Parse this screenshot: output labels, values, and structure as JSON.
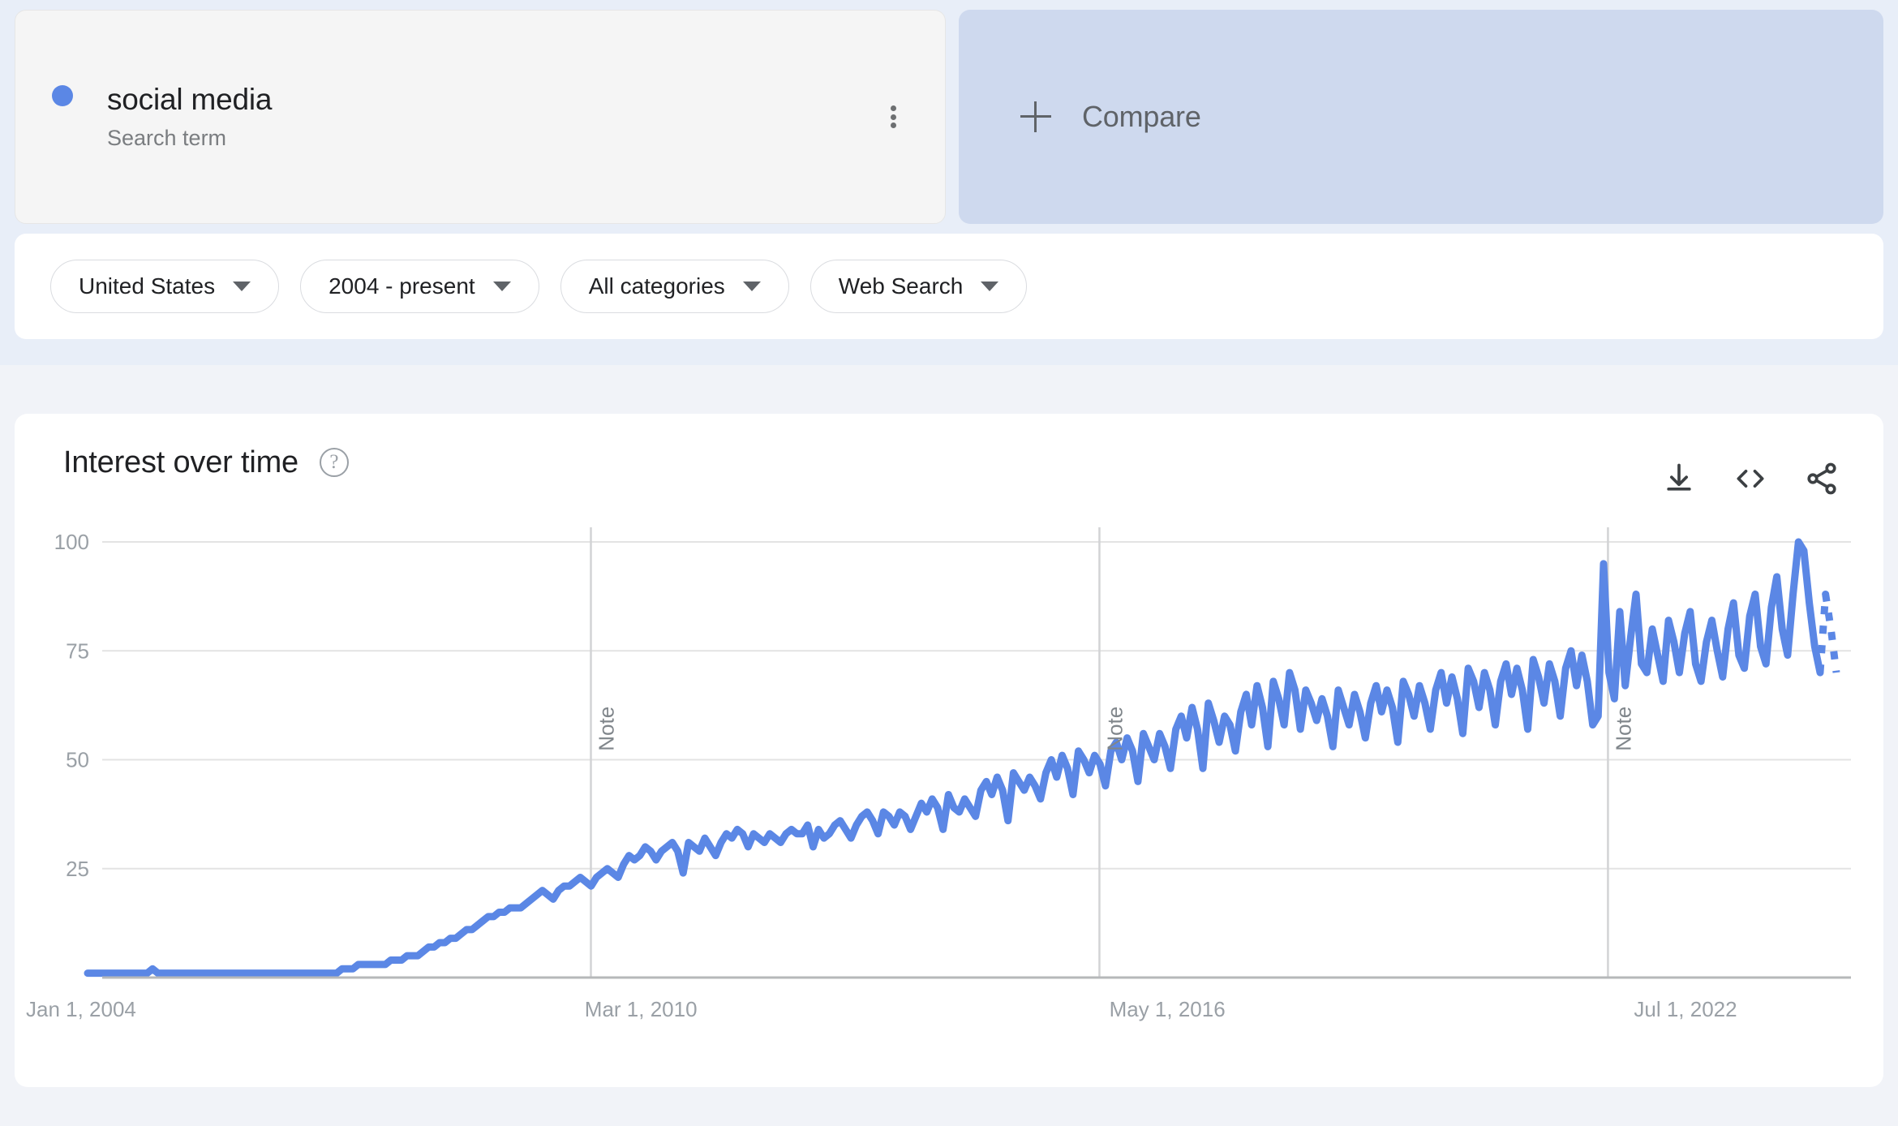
{
  "query": {
    "term": "social media",
    "type_label": "Search term",
    "dot_color": "#5b87e5",
    "menu_icon": "kebab-menu-icon"
  },
  "compare": {
    "label": "Compare",
    "icon": "plus-icon",
    "background": "#ced9ee"
  },
  "filters": [
    {
      "label": "United States",
      "name": "location"
    },
    {
      "label": "2004 - present",
      "name": "time-range"
    },
    {
      "label": "All categories",
      "name": "category"
    },
    {
      "label": "Web Search",
      "name": "search-type"
    }
  ],
  "chart_card": {
    "title": "Interest over time",
    "help_icon": "help-circle-icon",
    "actions": [
      {
        "name": "download-icon",
        "label": "Download"
      },
      {
        "name": "embed-code-icon",
        "label": "Embed"
      },
      {
        "name": "share-icon",
        "label": "Share"
      }
    ]
  },
  "chart_data": {
    "type": "line",
    "title": "Interest over time",
    "xlabel": "",
    "ylabel": "",
    "ylim": [
      0,
      100
    ],
    "xlim": [
      "Jan 1, 2004",
      "2024"
    ],
    "grid": true,
    "legend": false,
    "line_color": "#5b87e5",
    "y_ticks": [
      25,
      50,
      75,
      100
    ],
    "y_tick_labels": [
      "25",
      "50",
      "75",
      "100"
    ],
    "x_tick_labels": [
      "Jan 1, 2004",
      "Mar 1, 2010",
      "May 1, 2016",
      "Jul 1, 2022"
    ],
    "x_tick_positions": [
      0,
      0.3,
      0.6,
      0.9
    ],
    "annotations": [
      {
        "label": "Note",
        "x_fraction": 0.2878,
        "orientation": "vertical"
      },
      {
        "label": "Note",
        "x_fraction": 0.5786,
        "orientation": "vertical"
      },
      {
        "label": "Note",
        "x_fraction": 0.8694,
        "orientation": "vertical"
      }
    ],
    "series": [
      {
        "name": "social media",
        "dashed_tail_points": 3,
        "values": [
          1,
          1,
          1,
          1,
          1,
          1,
          1,
          1,
          1,
          1,
          1,
          1,
          2,
          1,
          1,
          1,
          1,
          1,
          1,
          1,
          1,
          1,
          1,
          1,
          1,
          1,
          1,
          1,
          1,
          1,
          1,
          1,
          1,
          1,
          1,
          1,
          1,
          1,
          1,
          1,
          1,
          1,
          1,
          1,
          1,
          1,
          1,
          2,
          2,
          2,
          3,
          3,
          3,
          3,
          3,
          3,
          4,
          4,
          4,
          5,
          5,
          5,
          6,
          7,
          7,
          8,
          8,
          9,
          9,
          10,
          11,
          11,
          12,
          13,
          14,
          14,
          15,
          15,
          16,
          16,
          16,
          17,
          18,
          19,
          20,
          19,
          18,
          20,
          21,
          21,
          22,
          23,
          22,
          21,
          23,
          24,
          25,
          24,
          23,
          26,
          28,
          27,
          28,
          30,
          29,
          27,
          29,
          30,
          31,
          29,
          24,
          31,
          30,
          29,
          32,
          30,
          28,
          31,
          33,
          32,
          34,
          33,
          30,
          33,
          32,
          31,
          33,
          32,
          31,
          33,
          34,
          33,
          33,
          35,
          30,
          34,
          32,
          33,
          35,
          36,
          34,
          32,
          35,
          37,
          38,
          36,
          33,
          38,
          37,
          35,
          38,
          37,
          34,
          37,
          40,
          38,
          41,
          39,
          34,
          42,
          39,
          38,
          41,
          39,
          37,
          43,
          45,
          42,
          46,
          43,
          36,
          47,
          45,
          43,
          46,
          44,
          41,
          47,
          50,
          46,
          51,
          48,
          42,
          52,
          50,
          47,
          51,
          49,
          44,
          52,
          54,
          50,
          55,
          52,
          45,
          56,
          53,
          50,
          56,
          53,
          48,
          57,
          60,
          55,
          62,
          57,
          48,
          63,
          59,
          54,
          60,
          58,
          52,
          61,
          65,
          58,
          67,
          62,
          53,
          68,
          64,
          58,
          70,
          66,
          57,
          66,
          63,
          59,
          64,
          60,
          53,
          66,
          62,
          58,
          65,
          61,
          55,
          63,
          67,
          61,
          66,
          62,
          54,
          68,
          65,
          60,
          67,
          63,
          57,
          66,
          70,
          63,
          69,
          64,
          56,
          71,
          68,
          62,
          70,
          66,
          58,
          68,
          72,
          65,
          71,
          66,
          57,
          73,
          69,
          63,
          72,
          68,
          60,
          71,
          75,
          67,
          74,
          68,
          58,
          60,
          95,
          70,
          64,
          84,
          67,
          78,
          88,
          72,
          70,
          80,
          74,
          68,
          82,
          77,
          70,
          79,
          84,
          72,
          68,
          77,
          82,
          75,
          69,
          80,
          86,
          74,
          71,
          83,
          88,
          76,
          72,
          85,
          92,
          80,
          74,
          88,
          100,
          98,
          86,
          76,
          70,
          88,
          80,
          70
        ]
      }
    ]
  }
}
